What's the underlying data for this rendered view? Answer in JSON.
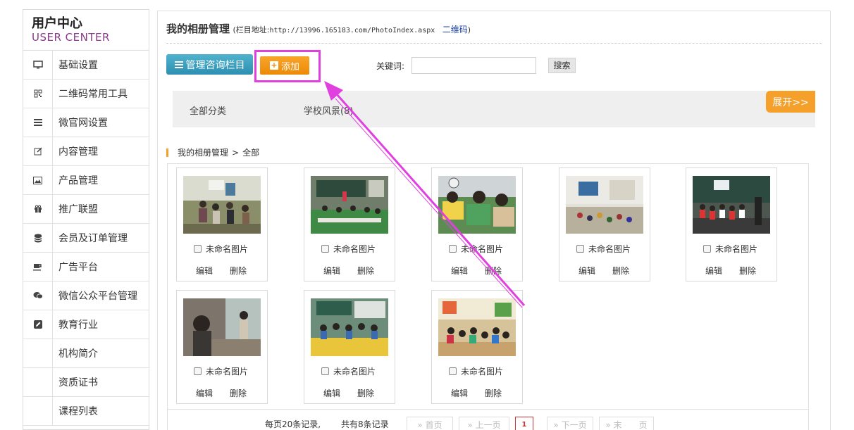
{
  "sidebar": {
    "brand_cn": "用户中心",
    "brand_en": "USER CENTER",
    "items": [
      {
        "label": "基础设置",
        "icon": "monitor-icon"
      },
      {
        "label": "二维码常用工具",
        "icon": "qrcode-icon"
      },
      {
        "label": "微官网设置",
        "icon": "menu-icon"
      },
      {
        "label": "内容管理",
        "icon": "edit-icon"
      },
      {
        "label": "产品管理",
        "icon": "image-icon"
      },
      {
        "label": "推广联盟",
        "icon": "gift-icon"
      },
      {
        "label": "会员及订单管理",
        "icon": "database-icon"
      },
      {
        "label": "广告平台",
        "icon": "coffee-icon"
      },
      {
        "label": "微信公众平台管理",
        "icon": "chat-icon"
      },
      {
        "label": "教育行业",
        "icon": "pencil-square-icon"
      }
    ],
    "sub_items": [
      "机构简介",
      "资质证书",
      "课程列表"
    ]
  },
  "header": {
    "title": "我的相册管理",
    "addr_prefix": "(栏目地址:",
    "addr_url": "http://13996.165183.com/PhotoIndex.aspx",
    "qr_link": "二维码",
    "addr_suffix": ")"
  },
  "toolbar": {
    "manage_label": "管理咨询栏目",
    "add_label": "添加",
    "keyword_label": "关键词:",
    "keyword_value": "",
    "search_label": "搜索"
  },
  "categories": {
    "items": [
      "全部分类",
      "学校风景(8)"
    ],
    "expand_label": "展开>>"
  },
  "breadcrumb": {
    "root": "我的相册管理",
    "sep": ">",
    "current": "全部"
  },
  "photos": [
    {
      "name": "未命名图片",
      "edit": "编辑",
      "del": "删除"
    },
    {
      "name": "未命名图片",
      "edit": "编辑",
      "del": "删除"
    },
    {
      "name": "未命名图片",
      "edit": "编辑",
      "del": "删除"
    },
    {
      "name": "未命名图片",
      "edit": "编辑",
      "del": "删除"
    },
    {
      "name": "未命名图片",
      "edit": "编辑",
      "del": "删除"
    },
    {
      "name": "未命名图片",
      "edit": "编辑",
      "del": "删除"
    },
    {
      "name": "未命名图片",
      "edit": "编辑",
      "del": "删除"
    },
    {
      "name": "未命名图片",
      "edit": "编辑",
      "del": "删除"
    }
  ],
  "pager": {
    "per_page": "每页20条记录,",
    "total": "共有8条记录",
    "first": "» 首页",
    "prev": "» 上一页",
    "current": "1",
    "next": "» 下一页",
    "last": "» 末　　页"
  },
  "colors": {
    "accent_orange": "#f5a02b",
    "accent_blue": "#2e8fb0",
    "highlight_magenta": "#e040e0"
  }
}
